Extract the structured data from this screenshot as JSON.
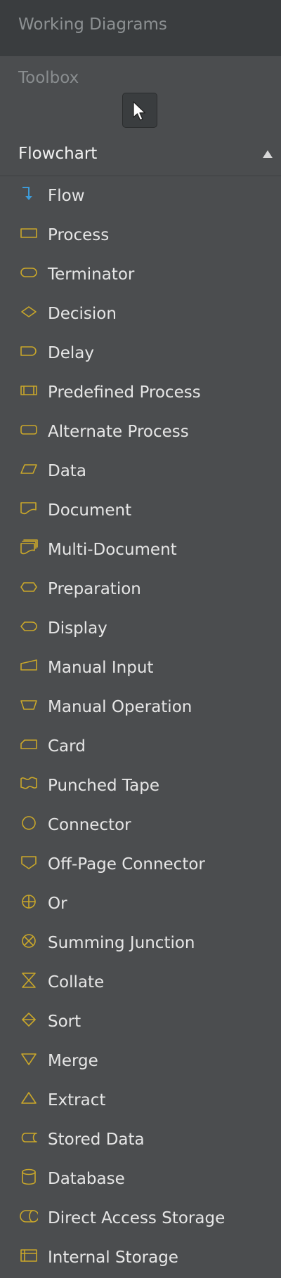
{
  "header": {
    "title": "Working Diagrams"
  },
  "toolbox": {
    "label": "Toolbox"
  },
  "section": {
    "label": "Flowchart",
    "expanded": true
  },
  "colors": {
    "icon": "#c9a72a",
    "flow_icon": "#3d9bd8"
  },
  "items": [
    {
      "label": "Flow",
      "icon": "flow-arrow-icon"
    },
    {
      "label": "Process",
      "icon": "process-rect-icon"
    },
    {
      "label": "Terminator",
      "icon": "terminator-icon"
    },
    {
      "label": "Decision",
      "icon": "decision-diamond-icon"
    },
    {
      "label": "Delay",
      "icon": "delay-icon"
    },
    {
      "label": "Predefined Process",
      "icon": "predefined-process-icon"
    },
    {
      "label": "Alternate Process",
      "icon": "alternate-process-icon"
    },
    {
      "label": "Data",
      "icon": "data-parallelogram-icon"
    },
    {
      "label": "Document",
      "icon": "document-icon"
    },
    {
      "label": "Multi-Document",
      "icon": "multi-document-icon"
    },
    {
      "label": "Preparation",
      "icon": "preparation-hexagon-icon"
    },
    {
      "label": "Display",
      "icon": "display-icon"
    },
    {
      "label": "Manual Input",
      "icon": "manual-input-icon"
    },
    {
      "label": "Manual Operation",
      "icon": "manual-operation-icon"
    },
    {
      "label": "Card",
      "icon": "card-icon"
    },
    {
      "label": "Punched Tape",
      "icon": "punched-tape-icon"
    },
    {
      "label": "Connector",
      "icon": "connector-circle-icon"
    },
    {
      "label": "Off-Page Connector",
      "icon": "off-page-connector-icon"
    },
    {
      "label": "Or",
      "icon": "or-icon"
    },
    {
      "label": "Summing Junction",
      "icon": "summing-junction-icon"
    },
    {
      "label": "Collate",
      "icon": "collate-icon"
    },
    {
      "label": "Sort",
      "icon": "sort-icon"
    },
    {
      "label": "Merge",
      "icon": "merge-triangle-icon"
    },
    {
      "label": "Extract",
      "icon": "extract-triangle-icon"
    },
    {
      "label": "Stored Data",
      "icon": "stored-data-icon"
    },
    {
      "label": "Database",
      "icon": "database-cylinder-icon"
    },
    {
      "label": "Direct Access Storage",
      "icon": "direct-access-storage-icon"
    },
    {
      "label": "Internal Storage",
      "icon": "internal-storage-icon"
    }
  ]
}
